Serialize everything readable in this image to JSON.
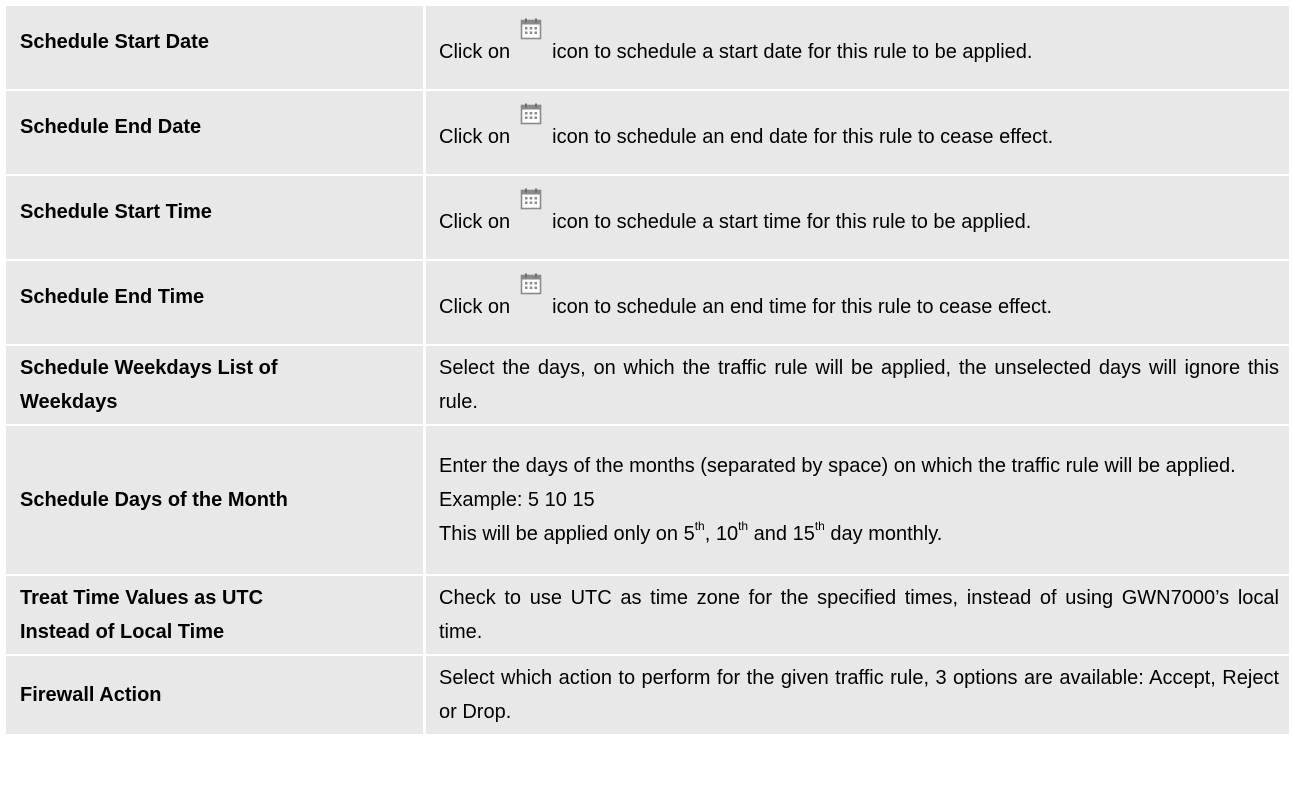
{
  "rows": [
    {
      "label": "Schedule Start Date",
      "before_icon": "Click on",
      "after_icon": "icon to schedule a start date for this rule to be applied."
    },
    {
      "label": "Schedule End Date",
      "before_icon": "Click on",
      "after_icon": "icon to schedule an end date for this rule to cease effect."
    },
    {
      "label": "Schedule Start Time",
      "before_icon": "Click on",
      "after_icon": "icon to schedule a start time for this rule to be applied."
    },
    {
      "label": "Schedule End Time",
      "before_icon": "Click on",
      "after_icon": "icon to schedule an end time for this rule to cease effect."
    },
    {
      "label_line1": "Schedule Weekdays List of",
      "label_line2": "Weekdays",
      "desc": "Select the days, on which the traffic rule will be applied, the unselected days will ignore this rule."
    },
    {
      "label": "Schedule Days of the Month",
      "desc_line1": "Enter the days of the months (separated by space) on which the traffic rule will be applied.",
      "desc_line2": "Example: 5 10 15",
      "desc_line3_a": "This will be applied only on 5",
      "desc_line3_sup1": "th",
      "desc_line3_b": ", 10",
      "desc_line3_sup2": "th",
      "desc_line3_c": " and 15",
      "desc_line3_sup3": "th",
      "desc_line3_d": " day monthly."
    },
    {
      "label_line1": "Treat Time Values as UTC",
      "label_line2": "Instead of Local Time",
      "desc": "Check to use UTC as time zone for the specified times, instead of using GWN7000’s local time."
    },
    {
      "label": "Firewall Action",
      "desc": "Select which action to perform for the given traffic rule, 3 options are available: Accept, Reject or Drop."
    }
  ],
  "icon": "calendar-icon"
}
